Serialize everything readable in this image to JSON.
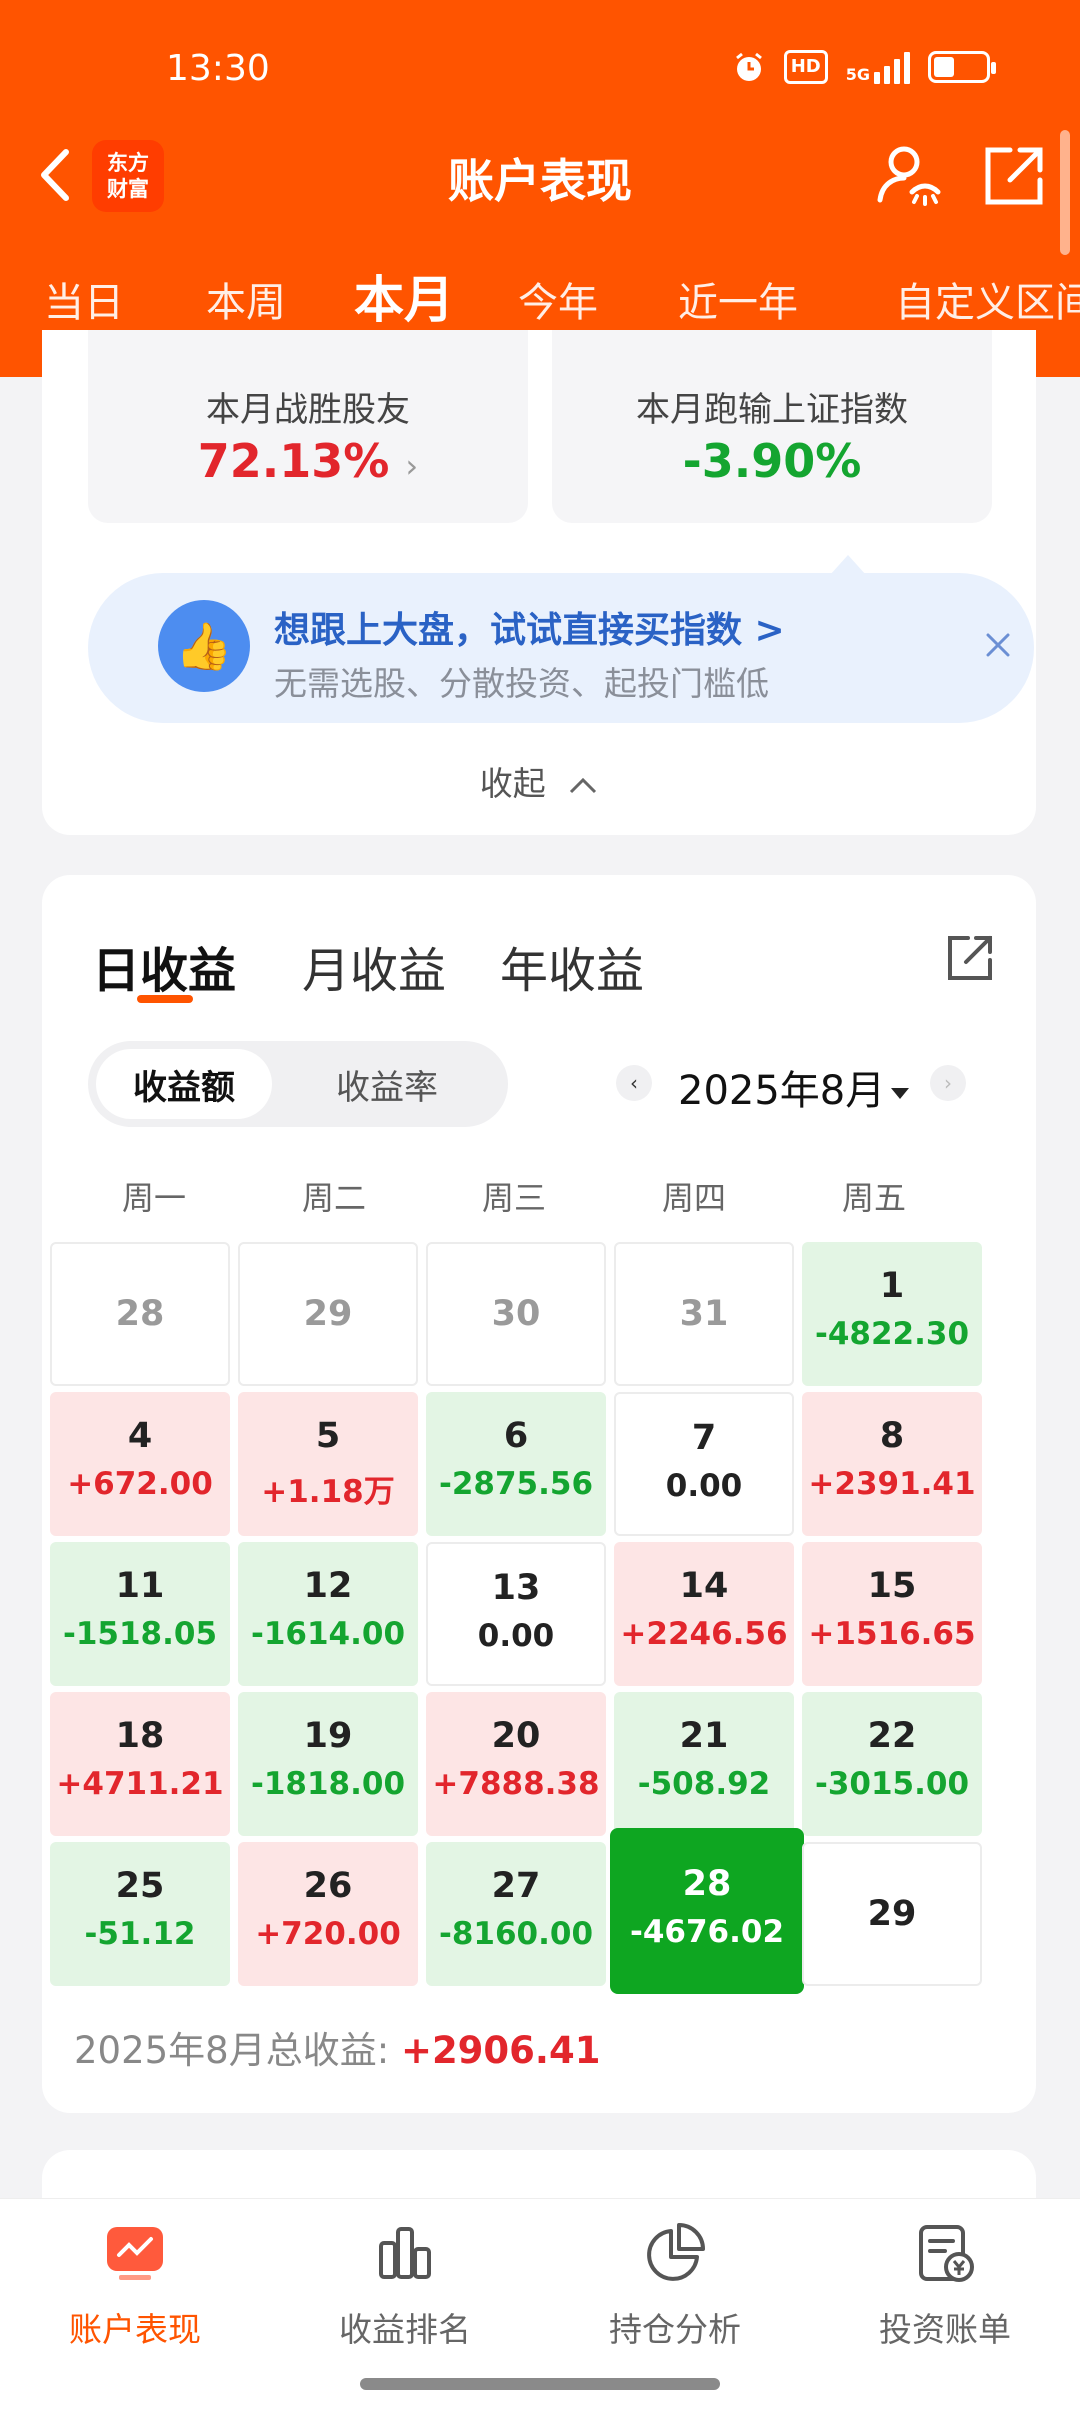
{
  "status_bar": {
    "time": "13:30",
    "hd": "HD",
    "network": "5G"
  },
  "header": {
    "title": "账户表现",
    "logo": [
      "东方",
      "财富"
    ],
    "tabs": [
      "当日",
      "本周",
      "本月",
      "今年",
      "近一年",
      "自定义区间"
    ],
    "active_tab": "本月"
  },
  "summary": {
    "beat_label": "本月战胜股友",
    "beat_value": "72.13%",
    "index_label": "本月跑输上证指数",
    "index_value": "-3.90%"
  },
  "promo": {
    "title": "想跟上大盘，试试直接买指数 >",
    "subtitle": "无需选股、分散投资、起投门槛低"
  },
  "collapse_label": "收起",
  "earnings": {
    "tabs": [
      "日收益",
      "月收益",
      "年收益"
    ],
    "toggle": [
      "收益额",
      "收益率"
    ],
    "month": "2025年8月",
    "weekdays": [
      "周一",
      "周二",
      "周三",
      "周四",
      "周五"
    ],
    "weeks": [
      [
        {
          "day": "28",
          "value": "",
          "type": "other"
        },
        {
          "day": "29",
          "value": "",
          "type": "other"
        },
        {
          "day": "30",
          "value": "",
          "type": "other"
        },
        {
          "day": "31",
          "value": "",
          "type": "other"
        },
        {
          "day": "1",
          "value": "-4822.30",
          "type": "loss"
        }
      ],
      [
        {
          "day": "4",
          "value": "+672.00",
          "type": "gain"
        },
        {
          "day": "5",
          "value": "+1.18万",
          "type": "gain"
        },
        {
          "day": "6",
          "value": "-2875.56",
          "type": "loss"
        },
        {
          "day": "7",
          "value": "0.00",
          "type": "zero"
        },
        {
          "day": "8",
          "value": "+2391.41",
          "type": "gain"
        }
      ],
      [
        {
          "day": "11",
          "value": "-1518.05",
          "type": "loss"
        },
        {
          "day": "12",
          "value": "-1614.00",
          "type": "loss"
        },
        {
          "day": "13",
          "value": "0.00",
          "type": "zero"
        },
        {
          "day": "14",
          "value": "+2246.56",
          "type": "gain"
        },
        {
          "day": "15",
          "value": "+1516.65",
          "type": "gain"
        }
      ],
      [
        {
          "day": "18",
          "value": "+4711.21",
          "type": "gain"
        },
        {
          "day": "19",
          "value": "-1818.00",
          "type": "loss"
        },
        {
          "day": "20",
          "value": "+7888.38",
          "type": "gain"
        },
        {
          "day": "21",
          "value": "-508.92",
          "type": "loss"
        },
        {
          "day": "22",
          "value": "-3015.00",
          "type": "loss"
        }
      ],
      [
        {
          "day": "25",
          "value": "-51.12",
          "type": "loss"
        },
        {
          "day": "26",
          "value": "+720.00",
          "type": "gain"
        },
        {
          "day": "27",
          "value": "-8160.00",
          "type": "loss"
        },
        {
          "day": "28",
          "value": "-4676.02",
          "type": "selected"
        },
        {
          "day": "29",
          "value": "",
          "type": "empty"
        }
      ]
    ],
    "total_label": "2025年8月总收益:",
    "total_value": "+2906.41"
  },
  "bottom_nav": [
    "账户表现",
    "收益排名",
    "持仓分析",
    "投资账单"
  ],
  "colors": {
    "brand": "#ff5400",
    "gain": "#e2262c",
    "loss": "#14a530",
    "selected": "#0ea621"
  }
}
